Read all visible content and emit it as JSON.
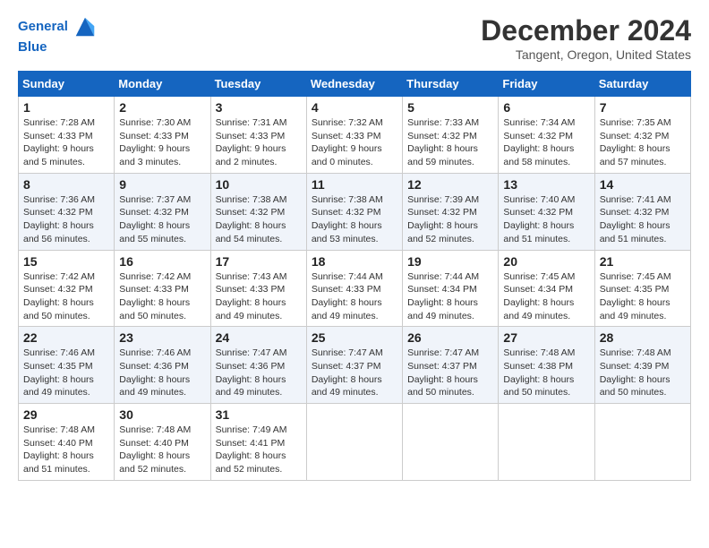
{
  "header": {
    "logo_line1": "General",
    "logo_line2": "Blue",
    "title": "December 2024",
    "subtitle": "Tangent, Oregon, United States"
  },
  "weekdays": [
    "Sunday",
    "Monday",
    "Tuesday",
    "Wednesday",
    "Thursday",
    "Friday",
    "Saturday"
  ],
  "weeks": [
    [
      {
        "day": "1",
        "info": "Sunrise: 7:28 AM\nSunset: 4:33 PM\nDaylight: 9 hours\nand 5 minutes."
      },
      {
        "day": "2",
        "info": "Sunrise: 7:30 AM\nSunset: 4:33 PM\nDaylight: 9 hours\nand 3 minutes."
      },
      {
        "day": "3",
        "info": "Sunrise: 7:31 AM\nSunset: 4:33 PM\nDaylight: 9 hours\nand 2 minutes."
      },
      {
        "day": "4",
        "info": "Sunrise: 7:32 AM\nSunset: 4:33 PM\nDaylight: 9 hours\nand 0 minutes."
      },
      {
        "day": "5",
        "info": "Sunrise: 7:33 AM\nSunset: 4:32 PM\nDaylight: 8 hours\nand 59 minutes."
      },
      {
        "day": "6",
        "info": "Sunrise: 7:34 AM\nSunset: 4:32 PM\nDaylight: 8 hours\nand 58 minutes."
      },
      {
        "day": "7",
        "info": "Sunrise: 7:35 AM\nSunset: 4:32 PM\nDaylight: 8 hours\nand 57 minutes."
      }
    ],
    [
      {
        "day": "8",
        "info": "Sunrise: 7:36 AM\nSunset: 4:32 PM\nDaylight: 8 hours\nand 56 minutes."
      },
      {
        "day": "9",
        "info": "Sunrise: 7:37 AM\nSunset: 4:32 PM\nDaylight: 8 hours\nand 55 minutes."
      },
      {
        "day": "10",
        "info": "Sunrise: 7:38 AM\nSunset: 4:32 PM\nDaylight: 8 hours\nand 54 minutes."
      },
      {
        "day": "11",
        "info": "Sunrise: 7:38 AM\nSunset: 4:32 PM\nDaylight: 8 hours\nand 53 minutes."
      },
      {
        "day": "12",
        "info": "Sunrise: 7:39 AM\nSunset: 4:32 PM\nDaylight: 8 hours\nand 52 minutes."
      },
      {
        "day": "13",
        "info": "Sunrise: 7:40 AM\nSunset: 4:32 PM\nDaylight: 8 hours\nand 51 minutes."
      },
      {
        "day": "14",
        "info": "Sunrise: 7:41 AM\nSunset: 4:32 PM\nDaylight: 8 hours\nand 51 minutes."
      }
    ],
    [
      {
        "day": "15",
        "info": "Sunrise: 7:42 AM\nSunset: 4:32 PM\nDaylight: 8 hours\nand 50 minutes."
      },
      {
        "day": "16",
        "info": "Sunrise: 7:42 AM\nSunset: 4:33 PM\nDaylight: 8 hours\nand 50 minutes."
      },
      {
        "day": "17",
        "info": "Sunrise: 7:43 AM\nSunset: 4:33 PM\nDaylight: 8 hours\nand 49 minutes."
      },
      {
        "day": "18",
        "info": "Sunrise: 7:44 AM\nSunset: 4:33 PM\nDaylight: 8 hours\nand 49 minutes."
      },
      {
        "day": "19",
        "info": "Sunrise: 7:44 AM\nSunset: 4:34 PM\nDaylight: 8 hours\nand 49 minutes."
      },
      {
        "day": "20",
        "info": "Sunrise: 7:45 AM\nSunset: 4:34 PM\nDaylight: 8 hours\nand 49 minutes."
      },
      {
        "day": "21",
        "info": "Sunrise: 7:45 AM\nSunset: 4:35 PM\nDaylight: 8 hours\nand 49 minutes."
      }
    ],
    [
      {
        "day": "22",
        "info": "Sunrise: 7:46 AM\nSunset: 4:35 PM\nDaylight: 8 hours\nand 49 minutes."
      },
      {
        "day": "23",
        "info": "Sunrise: 7:46 AM\nSunset: 4:36 PM\nDaylight: 8 hours\nand 49 minutes."
      },
      {
        "day": "24",
        "info": "Sunrise: 7:47 AM\nSunset: 4:36 PM\nDaylight: 8 hours\nand 49 minutes."
      },
      {
        "day": "25",
        "info": "Sunrise: 7:47 AM\nSunset: 4:37 PM\nDaylight: 8 hours\nand 49 minutes."
      },
      {
        "day": "26",
        "info": "Sunrise: 7:47 AM\nSunset: 4:37 PM\nDaylight: 8 hours\nand 50 minutes."
      },
      {
        "day": "27",
        "info": "Sunrise: 7:48 AM\nSunset: 4:38 PM\nDaylight: 8 hours\nand 50 minutes."
      },
      {
        "day": "28",
        "info": "Sunrise: 7:48 AM\nSunset: 4:39 PM\nDaylight: 8 hours\nand 50 minutes."
      }
    ],
    [
      {
        "day": "29",
        "info": "Sunrise: 7:48 AM\nSunset: 4:40 PM\nDaylight: 8 hours\nand 51 minutes."
      },
      {
        "day": "30",
        "info": "Sunrise: 7:48 AM\nSunset: 4:40 PM\nDaylight: 8 hours\nand 52 minutes."
      },
      {
        "day": "31",
        "info": "Sunrise: 7:49 AM\nSunset: 4:41 PM\nDaylight: 8 hours\nand 52 minutes."
      },
      null,
      null,
      null,
      null
    ]
  ]
}
